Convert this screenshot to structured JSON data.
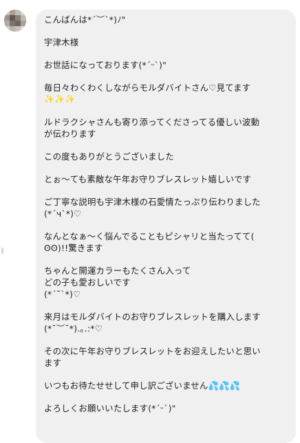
{
  "message": {
    "lines": [
      "こんばんは*´︶`*)ﾉ\"",
      "宇津木様",
      "お世話になっております(*ˊᵕˋ)\"",
      "毎日々わくわくしながらモルダバイトさん♡見てます",
      "✨✨✨",
      "ルドラクシャさんも寄り添ってくださってる優しい波動",
      "が伝わります",
      "この度もありがとうございました",
      "とぉ〜ても素敵な午年お守りブレスレット嬉しいです",
      "ご丁寧な説明も宇津木様の石愛情たっぷり伝わりました",
      "(*´ч`*)♡",
      "なんとなぁ〜く悩んでることもピシャリと当たってて(",
      "ʘʘ)!!驚きます",
      "ちゃんと開運カラーもたくさん入って",
      "どの子も愛おしいです",
      "(*´˘`*)♡",
      "来月はモルダバイトのお守りブレスレットを購入します",
      "(*˘︶˘*).｡.:*♡",
      "その次に午年お守りブレスレットをお迎えしたいと思い",
      "ます",
      "いつもお待たせせして申し訳ございません💦💦💦",
      "よろしくお願いいたします(*ˊᵕˋ)\""
    ]
  },
  "icons": {
    "avatar": "blurred-user-avatar-icon",
    "sparkles": "sparkles-emoji-icon",
    "sweat": "sweat-droplets-emoji-icon"
  },
  "colors": {
    "bubble_bg": "#f1f0f0",
    "text": "#1c1e21"
  }
}
